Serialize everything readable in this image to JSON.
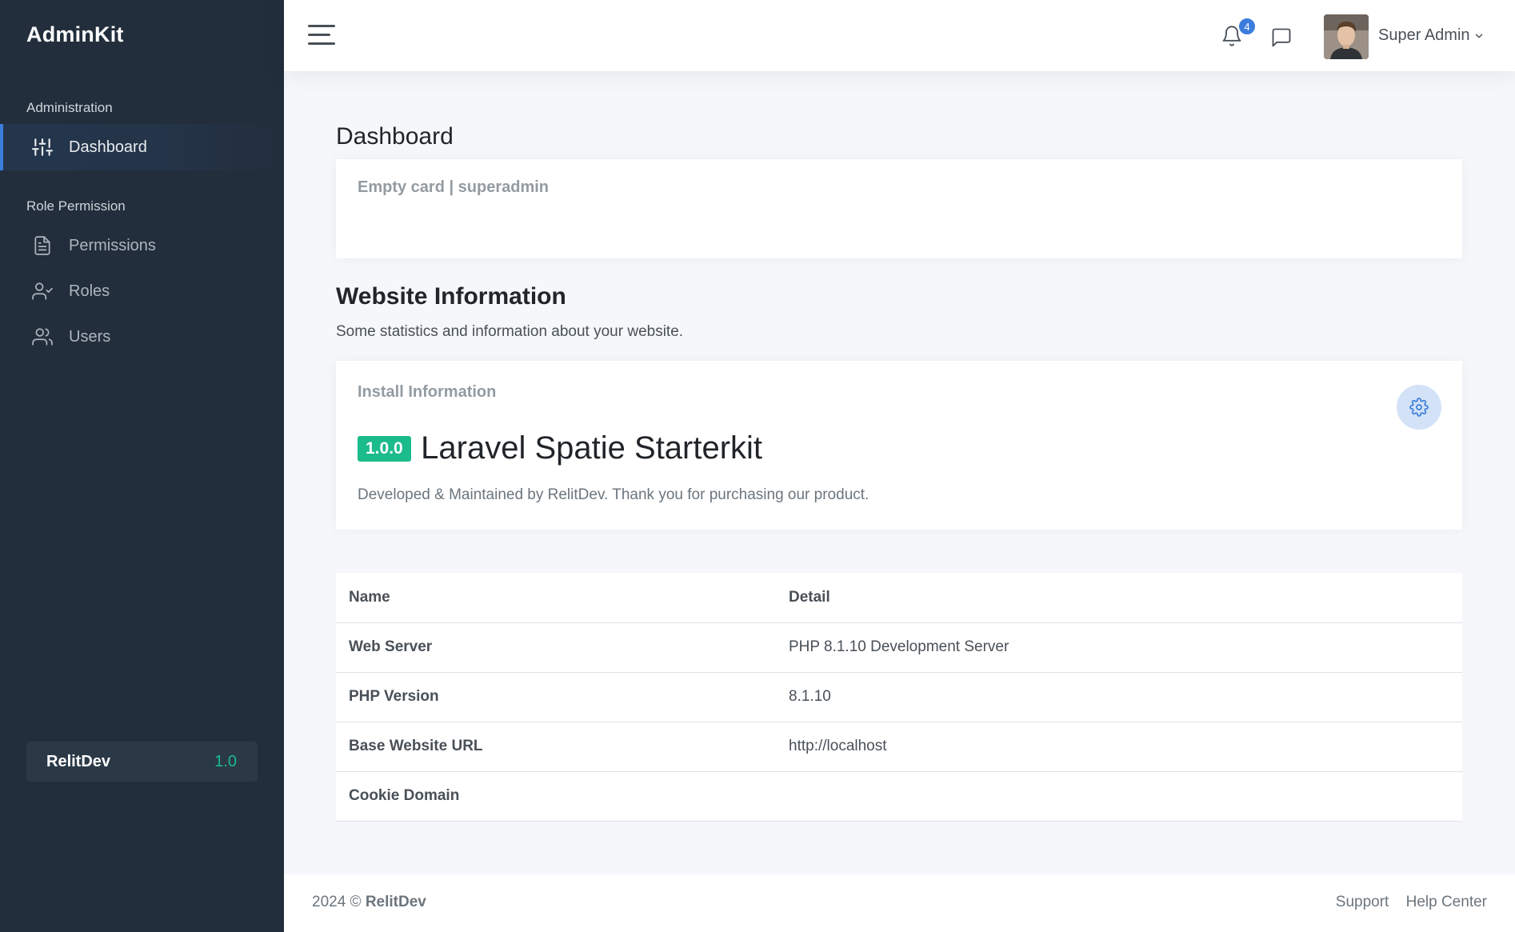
{
  "sidebar": {
    "brand": "AdminKit",
    "sections": [
      {
        "header": "Administration",
        "items": [
          {
            "label": "Dashboard",
            "icon": "sliders-icon",
            "active": true
          }
        ]
      },
      {
        "header": "Role Permission",
        "items": [
          {
            "label": "Permissions",
            "icon": "file-text-icon",
            "active": false
          },
          {
            "label": "Roles",
            "icon": "user-check-icon",
            "active": false
          },
          {
            "label": "Users",
            "icon": "users-icon",
            "active": false
          }
        ]
      }
    ],
    "cta": {
      "name": "RelitDev",
      "version": "1.0"
    }
  },
  "navbar": {
    "notification_count": "4",
    "user_name": "Super Admin",
    "icons": [
      "hamburger-icon",
      "bell-icon",
      "message-square-icon",
      "chevron-down-icon"
    ]
  },
  "main": {
    "page_title": "Dashboard",
    "empty_card_text": "Empty card | superadmin",
    "website_info": {
      "title": "Website Information",
      "subtitle": "Some statistics and information about your website."
    },
    "install_card": {
      "title": "Install Information",
      "version": "1.0.0",
      "product": "Laravel Spatie Starterkit",
      "description": "Developed & Maintained by RelitDev. Thank you for purchasing our product.",
      "icon": "settings-icon"
    },
    "table": {
      "headers": [
        "Name",
        "Detail"
      ],
      "rows": [
        {
          "name": "Web Server",
          "detail": "PHP 8.1.10 Development Server"
        },
        {
          "name": "PHP Version",
          "detail": "8.1.10"
        },
        {
          "name": "Base Website URL",
          "detail": "http://localhost"
        },
        {
          "name": "Cookie Domain",
          "detail": ""
        }
      ]
    }
  },
  "footer": {
    "year": "2024 ©",
    "brand": "RelitDev",
    "links": [
      "Support",
      "Help Center"
    ]
  },
  "colors": {
    "sidebar_bg": "#222e3c",
    "accent": "#3b7ddd",
    "success": "#1cbb8c",
    "page_bg": "#f5f7fb"
  }
}
